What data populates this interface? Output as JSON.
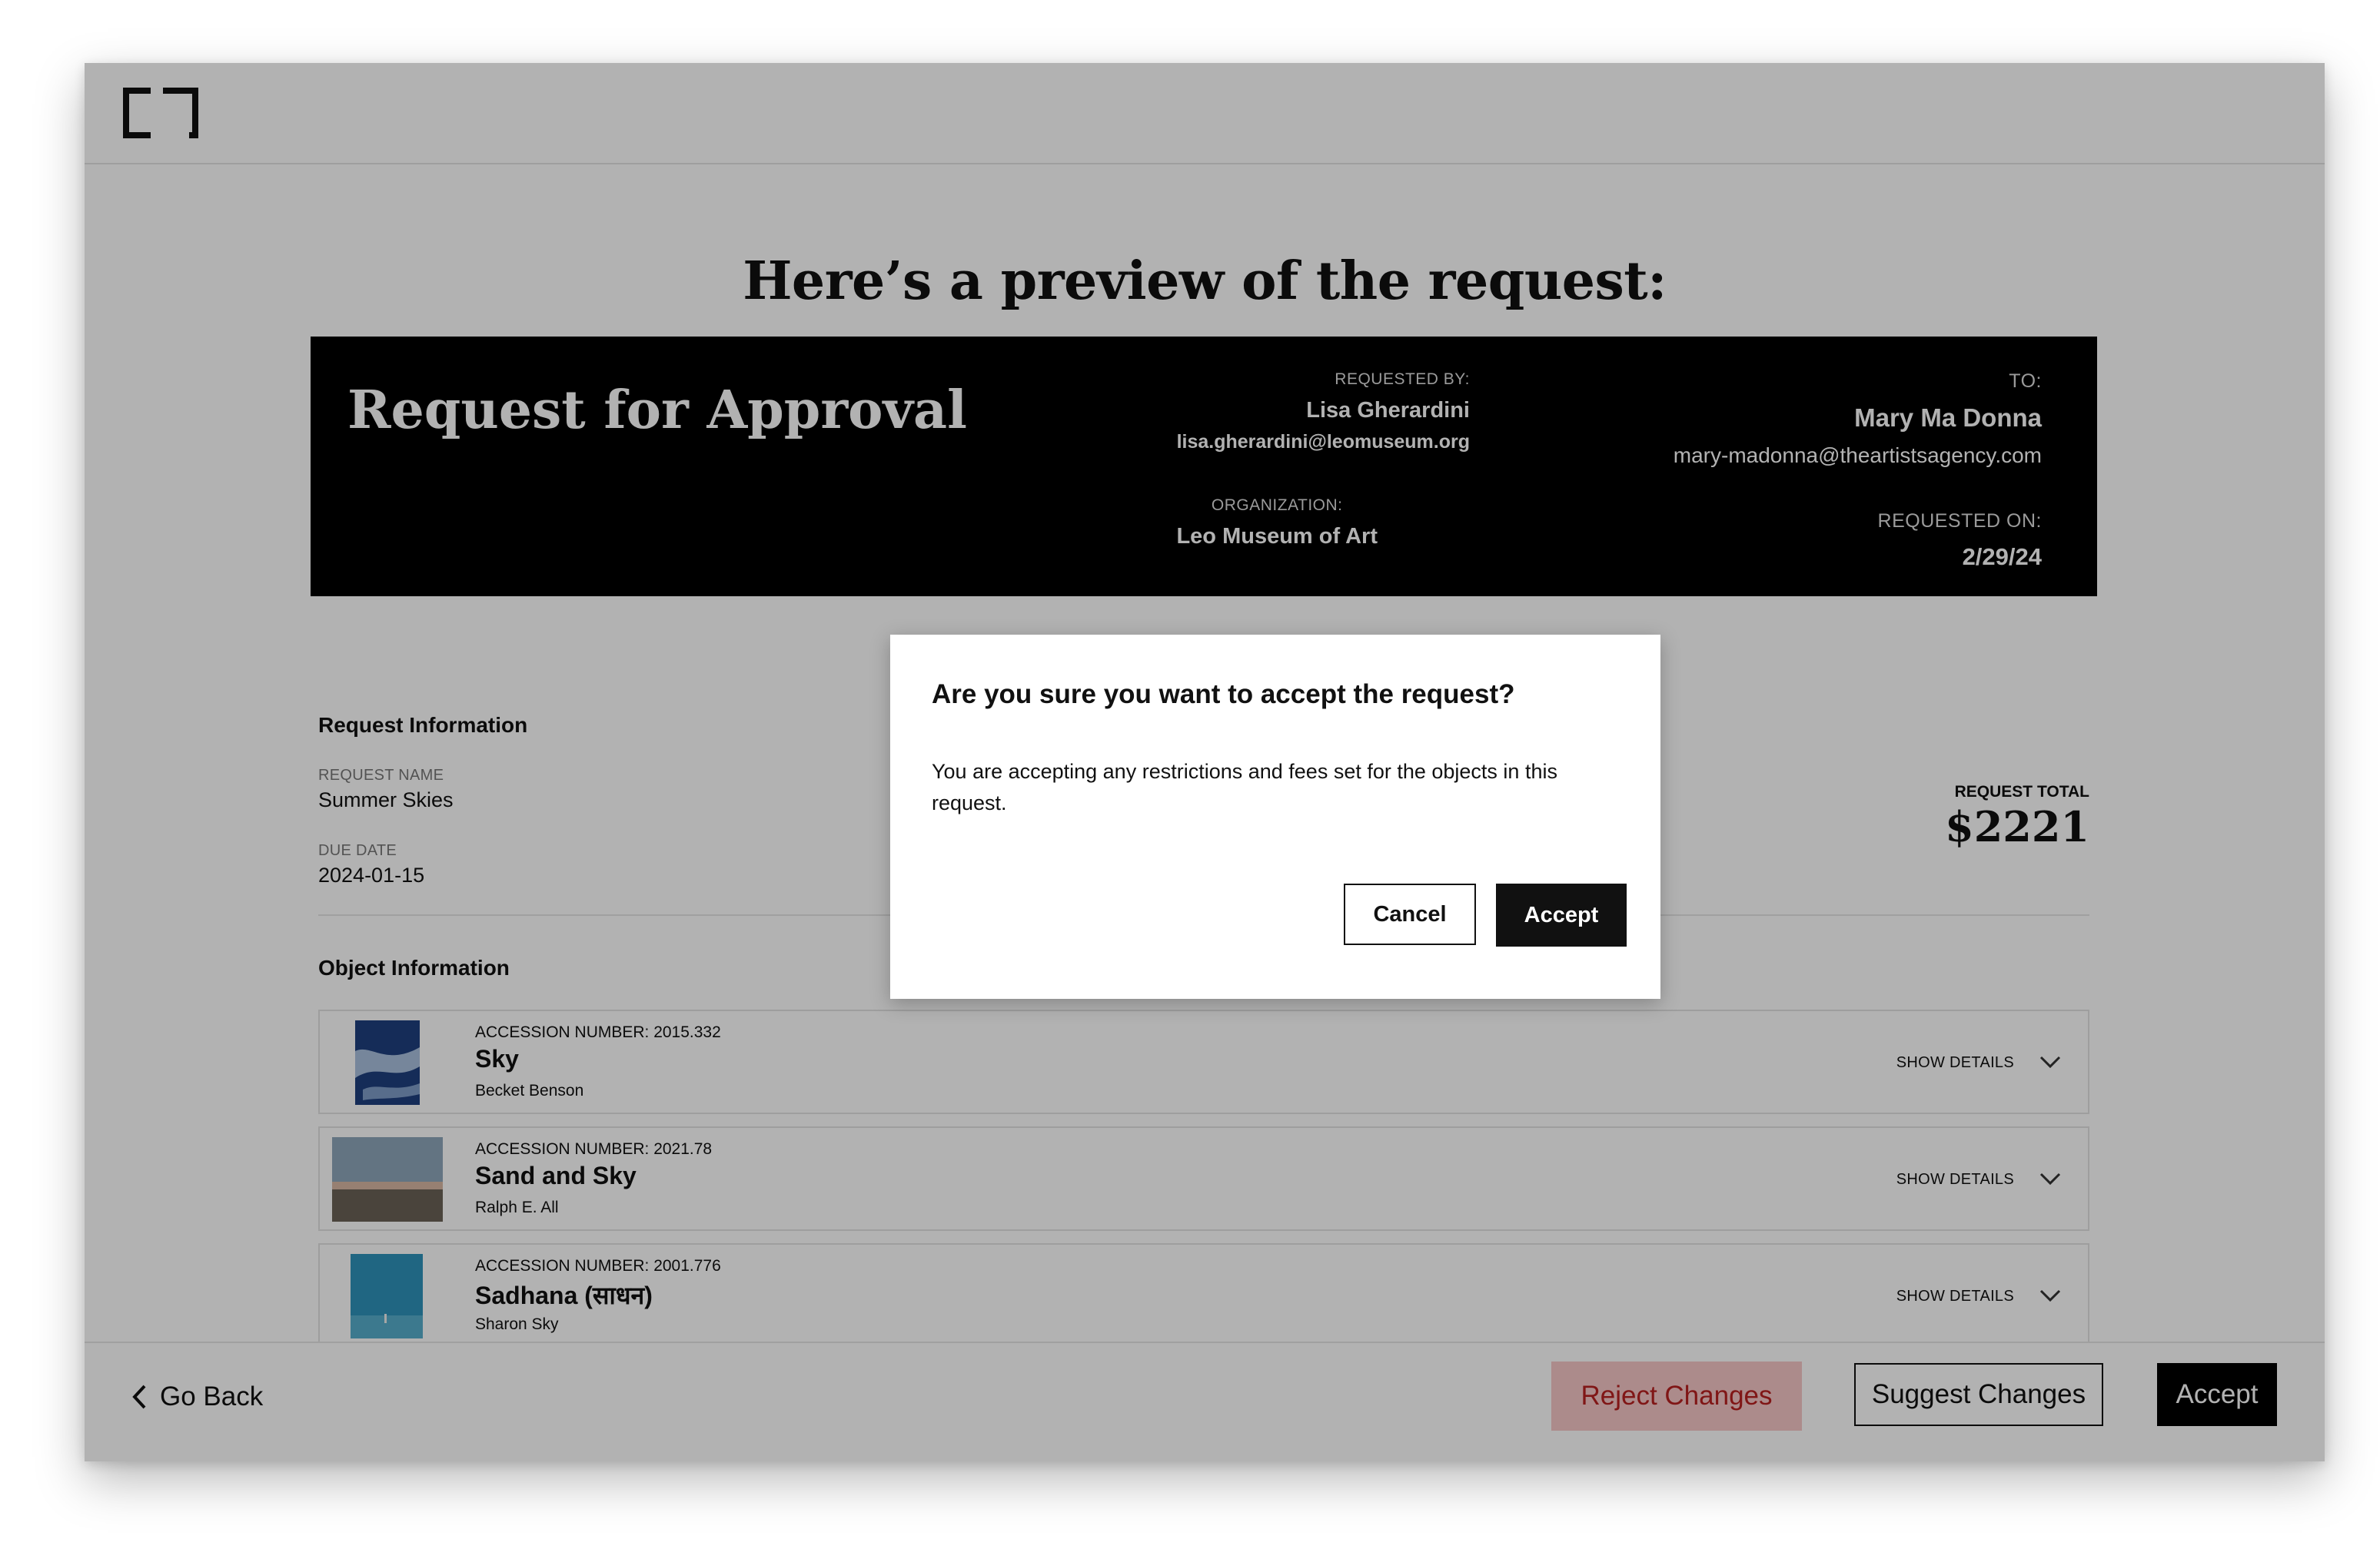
{
  "page": {
    "title": "Here’s a preview of the request:"
  },
  "request_header": {
    "title": "Request for Approval",
    "requested_by_label": "REQUESTED BY:",
    "requested_by_name": "Lisa Gherardini",
    "requested_by_email": "lisa.gherardini@leomuseum.org",
    "organization_label": "ORGANIZATION:",
    "organization_name": "Leo Museum of Art",
    "to_label": "TO:",
    "to_name": "Mary Ma Donna",
    "to_email": "mary-madonna@theartistsagency.com",
    "requested_on_label": "REQUESTED ON:",
    "requested_on_date": "2/29/24"
  },
  "request_info": {
    "section_title": "Request Information",
    "name_label": "REQUEST NAME",
    "name_value": "Summer Skies",
    "due_label": "DUE DATE",
    "due_value": "2024-01-15",
    "total_label": "REQUEST TOTAL",
    "total_value": "$2221"
  },
  "object_info": {
    "section_title": "Object Information",
    "show_details_label": "SHOW DETAILS",
    "objects": [
      {
        "accession": "ACCESSION NUMBER: 2015.332",
        "title": "Sky",
        "artist": "Becket Benson",
        "thumb_colors": [
          "#1c3c7a",
          "#9fb6d6"
        ]
      },
      {
        "accession": "ACCESSION NUMBER: 2021.78",
        "title": "Sand and Sky",
        "artist": "Ralph E. All",
        "thumb_colors": [
          "#8aa2b8",
          "#6b6257"
        ]
      },
      {
        "accession": "ACCESSION NUMBER: 2001.776",
        "title": "Sadhana (साधन)",
        "artist": "Sharon Sky",
        "thumb_colors": [
          "#2d8fb8",
          "#6fc2d8"
        ]
      }
    ]
  },
  "footer": {
    "go_back_label": "Go Back",
    "reject_label": "Reject Changes",
    "suggest_label": "Suggest Changes",
    "accept_label": "Accept"
  },
  "modal": {
    "title": "Are you sure you want to accept the request?",
    "body": "You are accepting any restrictions and fees set for the objects in this request.",
    "cancel_label": "Cancel",
    "accept_label": "Accept"
  },
  "colors": {
    "reject_bg": "#f7c7c7",
    "reject_text": "#b82020",
    "header_bg": "#000000",
    "overlay": "rgba(0,0,0,0.30)"
  }
}
